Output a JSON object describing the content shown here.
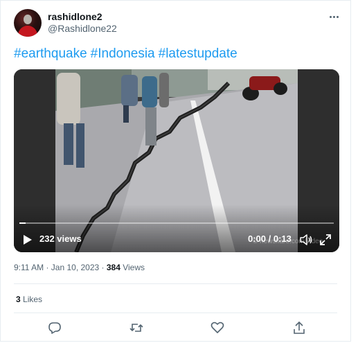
{
  "tweet": {
    "display_name": "rashidlone2",
    "handle": "@Rashidlone22",
    "hashtags": [
      "#earthquake",
      "#Indonesia",
      "#latestupdate"
    ],
    "timestamp": "9:11 AM · Jan 10, 2023 · ",
    "views_count": "384",
    "views_label": " Views",
    "likes_count": "3",
    "likes_label": " Likes"
  },
  "video": {
    "views_text": "232 views",
    "time_text": "0:00 / 0:13",
    "watermark": "© newsflare.com/video",
    "progress": 0.02
  },
  "icons": {
    "more": "more-horizontal-icon",
    "play": "play-icon",
    "volume": "volume-icon",
    "fullscreen": "fullscreen-icon",
    "reply": "reply-icon",
    "retweet": "retweet-icon",
    "like": "heart-icon",
    "share": "share-icon"
  },
  "colors": {
    "link": "#1d9bf0",
    "secondary_text": "#536471",
    "primary_text": "#0f1419"
  }
}
